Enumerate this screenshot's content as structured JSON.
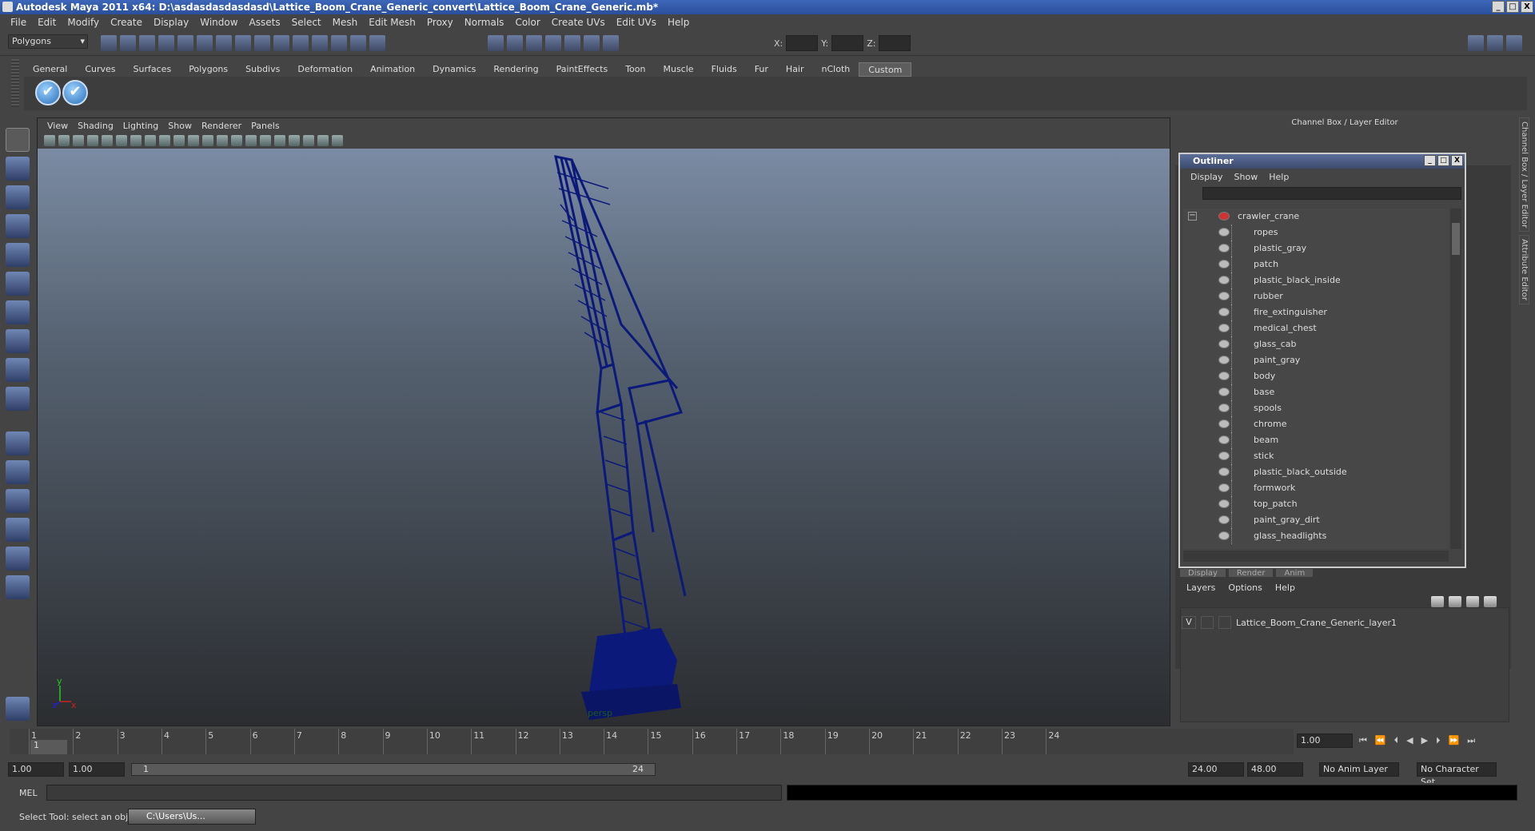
{
  "window": {
    "title": "Autodesk Maya 2011 x64: D:\\asdasdasdasdasd\\Lattice_Boom_Crane_Generic_convert\\Lattice_Boom_Crane_Generic.mb*",
    "minimize": "_",
    "maximize": "□",
    "close": "X"
  },
  "menu": [
    "File",
    "Edit",
    "Modify",
    "Create",
    "Display",
    "Window",
    "Assets",
    "Select",
    "Mesh",
    "Edit Mesh",
    "Proxy",
    "Normals",
    "Color",
    "Create UVs",
    "Edit UVs",
    "Help"
  ],
  "statusline": {
    "mode": "Polygons",
    "x_label": "X:",
    "y_label": "Y:",
    "z_label": "Z:"
  },
  "shelf": {
    "tabs": [
      "General",
      "Curves",
      "Surfaces",
      "Polygons",
      "Subdivs",
      "Deformation",
      "Animation",
      "Dynamics",
      "Rendering",
      "PaintEffects",
      "Toon",
      "Muscle",
      "Fluids",
      "Fur",
      "Hair",
      "nCloth",
      "Custom"
    ],
    "active": "Custom",
    "button_glyph": "✔"
  },
  "viewport": {
    "menu": [
      "View",
      "Shading",
      "Lighting",
      "Show",
      "Renderer",
      "Panels"
    ],
    "camera": "persp",
    "axis_y": "y",
    "axis_x": "x",
    "axis_z": "z"
  },
  "channelbox": {
    "title": "Channel Box / Layer Editor",
    "sidetab1": "Channel Box / Layer Editor",
    "sidetab2": "Attribute Editor"
  },
  "outliner": {
    "title": "Outliner",
    "menu": [
      "Display",
      "Show",
      "Help"
    ],
    "root": "crawler_crane",
    "items": [
      "ropes",
      "plastic_gray",
      "patch",
      "plastic_black_inside",
      "rubber",
      "fire_extinguisher",
      "medical_chest",
      "glass_cab",
      "paint_gray",
      "body",
      "base",
      "spools",
      "chrome",
      "beam",
      "stick",
      "plastic_black_outside",
      "formwork",
      "top_patch",
      "paint_gray_dirt",
      "glass_headlights"
    ]
  },
  "layers": {
    "tabs": [
      "Display",
      "Render",
      "Anim"
    ],
    "menu": [
      "Layers",
      "Options",
      "Help"
    ],
    "layer_visibility": "V",
    "layer_name": "Lattice_Boom_Crane_Generic_layer1"
  },
  "timeline": {
    "ticks": [
      "1",
      "2",
      "3",
      "4",
      "5",
      "6",
      "7",
      "8",
      "9",
      "10",
      "11",
      "12",
      "13",
      "14",
      "15",
      "16",
      "17",
      "18",
      "19",
      "20",
      "21",
      "22",
      "23",
      "24"
    ],
    "current": "1",
    "current_frame_field": "1.00"
  },
  "range": {
    "start": "1.00",
    "playback_start": "1.00",
    "slider_start": "1",
    "slider_end": "24",
    "playback_end": "24.00",
    "end": "48.00",
    "anim_layer": "No Anim Layer",
    "char_set": "No Character Set"
  },
  "mel": {
    "label": "MEL"
  },
  "help": {
    "text": "Select Tool: select an object",
    "task": "C:\\Users\\Us..."
  }
}
